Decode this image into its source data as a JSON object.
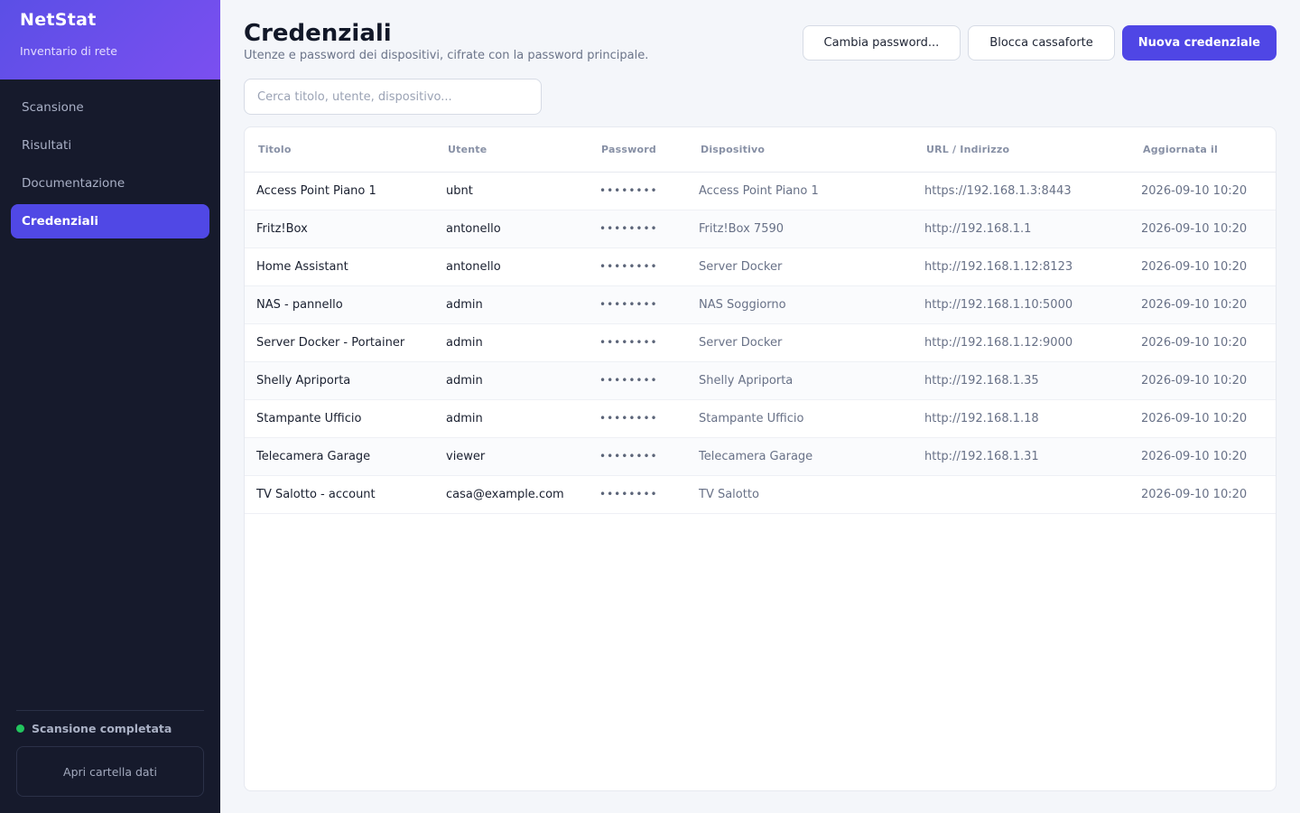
{
  "sidebar": {
    "brand_title": "NetStat",
    "brand_subtitle": "Inventario di rete",
    "items": [
      {
        "label": "Scansione",
        "active": false
      },
      {
        "label": "Risultati",
        "active": false
      },
      {
        "label": "Documentazione",
        "active": false
      },
      {
        "label": "Credenziali",
        "active": true
      }
    ],
    "status_text": "Scansione completata",
    "status_color": "#22c55e",
    "open_folder_label": "Apri cartella dati"
  },
  "header": {
    "title": "Credenziali",
    "subtitle": "Utenze e password dei dispositivi, cifrate con la password principale.",
    "change_password_label": "Cambia password...",
    "lock_vault_label": "Blocca cassaforte",
    "new_credential_label": "Nuova credenziale"
  },
  "search": {
    "placeholder": "Cerca titolo, utente, dispositivo...",
    "value": ""
  },
  "table": {
    "columns": [
      "Titolo",
      "Utente",
      "Password",
      "Dispositivo",
      "URL / Indirizzo",
      "Aggiornata il"
    ],
    "rows": [
      {
        "title": "Access Point Piano 1",
        "user": "ubnt",
        "password": "••••••••",
        "device": "Access Point Piano 1",
        "url": "https://192.168.1.3:8443",
        "updated": "2026-09-10 10:20"
      },
      {
        "title": "Fritz!Box",
        "user": "antonello",
        "password": "••••••••",
        "device": "Fritz!Box 7590",
        "url": "http://192.168.1.1",
        "updated": "2026-09-10 10:20"
      },
      {
        "title": "Home Assistant",
        "user": "antonello",
        "password": "••••••••",
        "device": "Server Docker",
        "url": "http://192.168.1.12:8123",
        "updated": "2026-09-10 10:20"
      },
      {
        "title": "NAS - pannello",
        "user": "admin",
        "password": "••••••••",
        "device": "NAS Soggiorno",
        "url": "http://192.168.1.10:5000",
        "updated": "2026-09-10 10:20"
      },
      {
        "title": "Server Docker - Portainer",
        "user": "admin",
        "password": "••••••••",
        "device": "Server Docker",
        "url": "http://192.168.1.12:9000",
        "updated": "2026-09-10 10:20"
      },
      {
        "title": "Shelly Apriporta",
        "user": "admin",
        "password": "••••••••",
        "device": "Shelly Apriporta",
        "url": "http://192.168.1.35",
        "updated": "2026-09-10 10:20"
      },
      {
        "title": "Stampante Ufficio",
        "user": "admin",
        "password": "••••••••",
        "device": "Stampante Ufficio",
        "url": "http://192.168.1.18",
        "updated": "2026-09-10 10:20"
      },
      {
        "title": "Telecamera Garage",
        "user": "viewer",
        "password": "••••••••",
        "device": "Telecamera Garage",
        "url": "http://192.168.1.31",
        "updated": "2026-09-10 10:20"
      },
      {
        "title": "TV Salotto - account",
        "user": "casa@example.com",
        "password": "••••••••",
        "device": "TV Salotto",
        "url": "",
        "updated": "2026-09-10 10:20"
      }
    ]
  }
}
